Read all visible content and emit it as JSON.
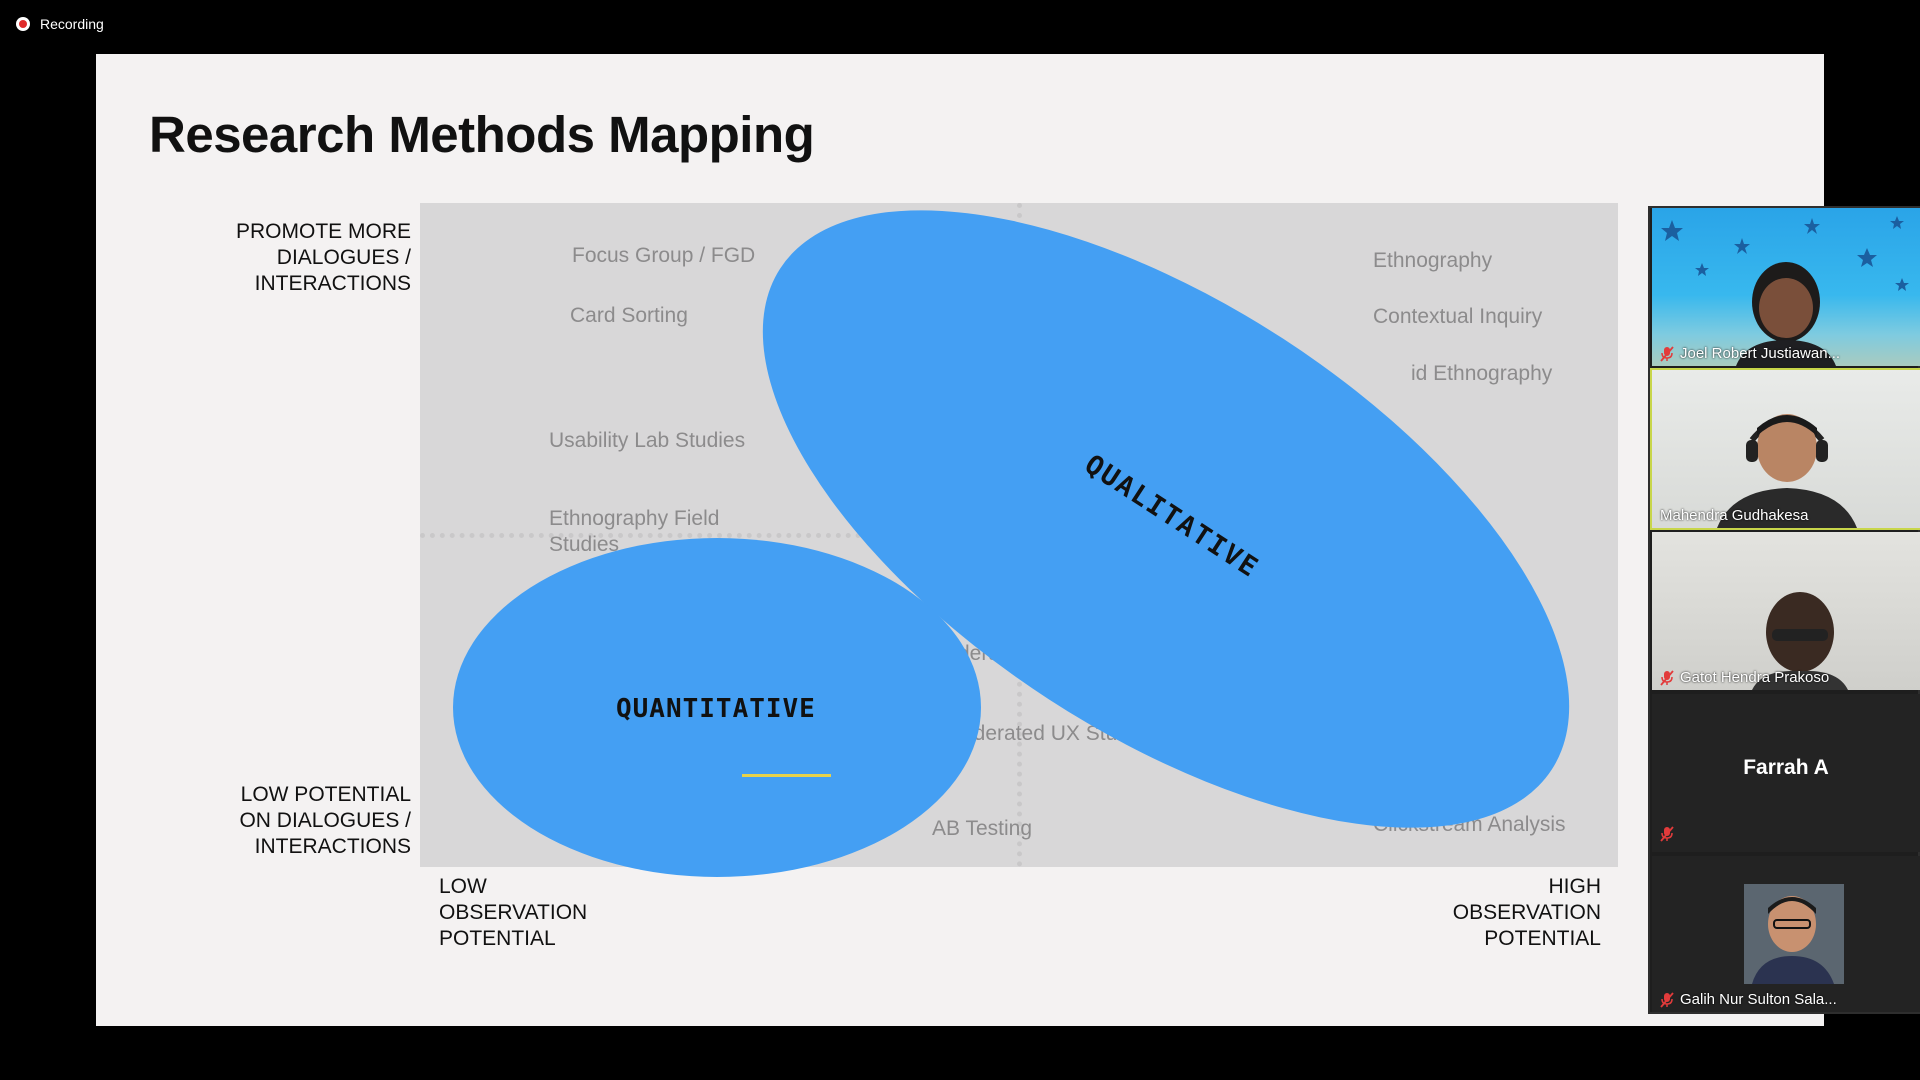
{
  "recording": {
    "label": "Recording",
    "colors": {
      "dot": "#e02b2b"
    }
  },
  "slide": {
    "title": "Research Methods Mapping",
    "y_axis": {
      "top_label": "PROMOTE MORE\nDIALOGUES /\nINTERACTIONS",
      "bottom_label": "LOW POTENTIAL\nON DIALOGUES /\nINTERACTIONS"
    },
    "x_axis": {
      "left_label": "LOW\nOBSERVATION\nPOTENTIAL",
      "right_label": "HIGH\nOBSERVATION\nPOTENTIAL"
    },
    "methods": {
      "focus_group": "Focus Group / FGD",
      "card_sorting": "Card Sorting",
      "usability_lab": "Usability Lab Studies",
      "ethnography_field": "Ethnography Field\nStudies",
      "ethnography": "Ethnography",
      "contextual_inquiry": "Contextual Inquiry",
      "remote_ethnography": "id Ethnography",
      "moderated_partial": "derated",
      "m_partial": "M",
      "unmoderated_ux": "oderated UX Studies",
      "ab_testing": "AB Testing",
      "clickstream": "Clickstream Analysis"
    },
    "clusters": {
      "qualitative": "QUALITATIVE",
      "quantitative": "QUANTITATIVE"
    },
    "colors": {
      "ellipse": "#449ff3",
      "quadrant": "#d8d7d8",
      "slide_bg": "#f4f2f2",
      "underline": "#e8d24a"
    }
  },
  "participants": [
    {
      "name": "Joel Robert Justiawan...",
      "muted": true,
      "video": true
    },
    {
      "name": "Mahendra Gudhakesa",
      "muted": false,
      "video": true
    },
    {
      "name": "Gatot Hendra Prakoso",
      "muted": true,
      "video": true
    },
    {
      "name": "Farrah A",
      "muted": true,
      "video": false
    },
    {
      "name": "Galih Nur Sulton Sala...",
      "muted": true,
      "video": true
    }
  ]
}
